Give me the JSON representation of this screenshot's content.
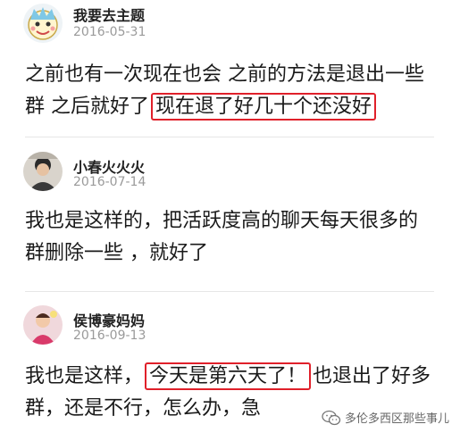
{
  "comments": [
    {
      "username": "我要去主题",
      "date": "2016-05-31",
      "avatar_icon": "cartoon-face-icon",
      "line1": "之前也有一次现在也会 之前的方法是退出一些",
      "line2_pre": "群 之后就好了",
      "line2_highlight": "现在退了好几十个还没好"
    },
    {
      "username": "小春火火火",
      "date": "2016-07-14",
      "avatar_icon": "photo-avatar-icon",
      "line1": "我也是这样的，把活跃度高的聊天每天很多的",
      "line2": "群删除一些 ，就好了"
    },
    {
      "username": "侯博豪妈妈",
      "date": "2016-09-13",
      "avatar_icon": "child-photo-avatar-icon",
      "line1_pre": "我也是这样，",
      "line1_highlight": "今天是第六天了！",
      "line1_post": "也退出了好多",
      "line2": "群，还是不行，怎么办，急"
    }
  ],
  "watermark": {
    "text": "多伦多西区那些事儿",
    "icon": "wechat-icon"
  },
  "colors": {
    "highlight_border": "#e0202a",
    "date_gray": "#9a9a9a",
    "divider": "#e6e6e6"
  }
}
